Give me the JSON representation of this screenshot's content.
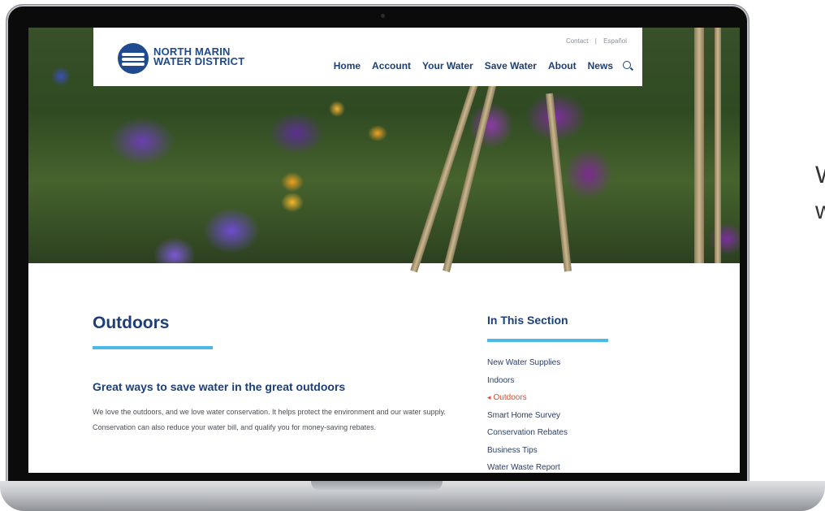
{
  "header": {
    "logo_line1": "NORTH MARIN",
    "logo_line2": "WATER DISTRICT",
    "utility": [
      "Contact",
      "|",
      "Español"
    ],
    "nav": [
      "Home",
      "Account",
      "Your Water",
      "Save Water",
      "About",
      "News"
    ]
  },
  "main": {
    "title": "Outdoors",
    "subtitle": "Great ways to save water in the great outdoors",
    "body": "We love the outdoors, and we love water conservation. It helps protect the environment and our water supply. Conservation can also reduce your water bill, and qualify you for money-saving rebates."
  },
  "sidebar": {
    "heading": "In This Section",
    "items": [
      {
        "label": "New Water Supplies",
        "active": false
      },
      {
        "label": "Indoors",
        "active": false
      },
      {
        "label": "Outdoors",
        "active": true
      },
      {
        "label": "Smart Home Survey",
        "active": false
      },
      {
        "label": "Conservation Rebates",
        "active": false
      },
      {
        "label": "Business Tips",
        "active": false
      },
      {
        "label": "Water Waste Report",
        "active": false
      }
    ]
  },
  "side_text": [
    "W",
    "w"
  ],
  "colors": {
    "brand_navy": "#1d3f78",
    "accent_blue": "#4cb8e8",
    "active_red": "#e44a2a"
  },
  "icons": {
    "search": "search-icon",
    "logo": "water-waves-logo"
  }
}
